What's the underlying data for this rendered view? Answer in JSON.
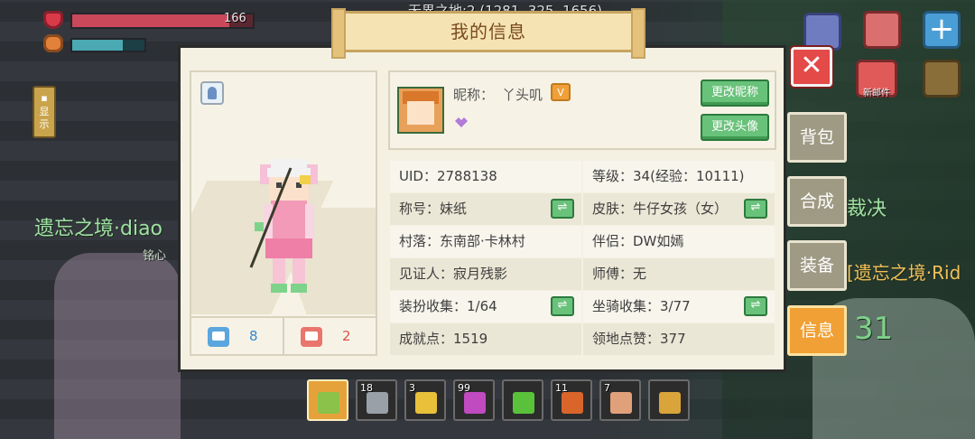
{
  "hud": {
    "hp_value": "166",
    "hp_fraction": 0.87,
    "hunger_fraction": 0.7,
    "show_label": "显示",
    "coords": "无界之地:2 (1281, 325, 1656)"
  },
  "world": {
    "left_name": "遗忘之境·diao",
    "left_sub": "铭心",
    "right_name": "裁决",
    "right_name2": "[遗忘之境·Rid",
    "right_num": "31",
    "mail_label": "新邮件"
  },
  "panel": {
    "title": "我的信息",
    "close_icon": "close-x",
    "likes": "8",
    "dislikes": "2",
    "nickname_label": "昵称：",
    "nickname": "丫头叽",
    "change_nickname": "更改昵称",
    "change_avatar": "更改头像"
  },
  "stats": [
    {
      "left": "UID：2788138",
      "left_swap": false,
      "right": "等级：34(经验：10111)",
      "right_swap": false
    },
    {
      "left": "称号：妹纸",
      "left_swap": true,
      "right": "皮肤：牛仔女孩（女）",
      "right_swap": true
    },
    {
      "left": "村落：东南部·卡林村",
      "left_swap": false,
      "right": "伴侣：DW如嫣",
      "right_swap": false
    },
    {
      "left": "见证人：寂月残影",
      "left_swap": false,
      "right": "师傅：无",
      "right_swap": false
    },
    {
      "left": "装扮收集：1/64",
      "left_swap": true,
      "right": "坐骑收集：3/77",
      "right_swap": true
    },
    {
      "left": "成就点：1519",
      "left_swap": false,
      "right": "领地点赞：377",
      "right_swap": false
    }
  ],
  "side_tabs": [
    {
      "label": "背包",
      "active": false
    },
    {
      "label": "合成",
      "active": false
    },
    {
      "label": "装备",
      "active": false
    },
    {
      "label": "信息",
      "active": true
    }
  ],
  "hotbar": [
    {
      "count": "",
      "icon": "bow-icon",
      "color": "#8ac24a",
      "selected": true
    },
    {
      "count": "18",
      "icon": "gear-block-icon",
      "color": "#9aa0a8",
      "selected": false
    },
    {
      "count": "3",
      "icon": "gold-ingot-icon",
      "color": "#e8c03a",
      "selected": false
    },
    {
      "count": "99",
      "icon": "potion-icon",
      "color": "#c04ac0",
      "selected": false
    },
    {
      "count": "",
      "icon": "triangle-gem-icon",
      "color": "#5ac23a",
      "selected": false
    },
    {
      "count": "11",
      "icon": "roast-meat-icon",
      "color": "#d9652b",
      "selected": false
    },
    {
      "count": "7",
      "icon": "soup-bowl-icon",
      "color": "#e0a07a",
      "selected": false
    },
    {
      "count": "",
      "icon": "beer-mug-icon",
      "color": "#d9a53a",
      "selected": false
    }
  ]
}
